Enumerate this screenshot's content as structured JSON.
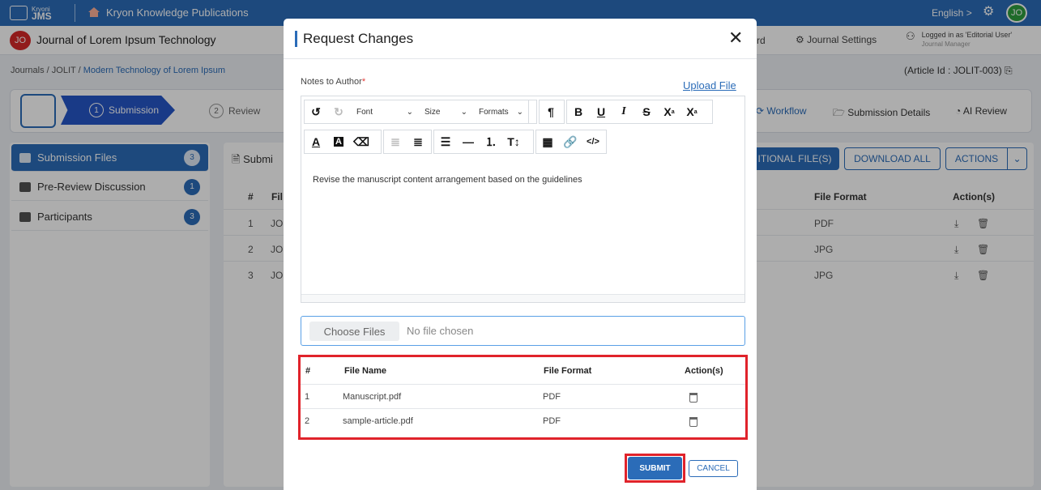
{
  "topbar": {
    "logo_top": "Kryoni",
    "logo_bottom": "JMS",
    "publisher": "Kryon Knowledge Publications",
    "language": "English >",
    "avatar": "JO"
  },
  "journal_bar": {
    "avatar": "JO",
    "title": "Journal of Lorem Ipsum Technology",
    "partial_item": "rd",
    "settings": "Journal Settings",
    "logged_in": "Logged in as 'Editorial User'",
    "role": "Journal Manager"
  },
  "breadcrumb": {
    "journals": "Journals",
    "sep1": "/",
    "code": "JOLIT",
    "sep2": "/",
    "article": "Modern Technology of Lorem Ipsum"
  },
  "article_id": "(Article Id : JOLIT-003)",
  "stepper": {
    "active_num": "1",
    "active_label": "Submission",
    "review_num": "2",
    "review_label": "Review",
    "workflow": "Workflow",
    "submission_details": "Submission Details",
    "ai_review": "AI Review"
  },
  "left_panel": [
    {
      "label": "Submission Files",
      "count": "3"
    },
    {
      "label": "Pre-Review Discussion",
      "count": "1"
    },
    {
      "label": "Participants",
      "count": "3"
    }
  ],
  "main_panel": {
    "title": "Submi",
    "btn_additional": "ITIONAL FILE(S)",
    "btn_download": "DOWNLOAD ALL",
    "btn_actions": "ACTIONS",
    "col_num": "#",
    "col_file": "Fil",
    "col_format": "File Format",
    "col_action": "Action(s)",
    "rows": [
      {
        "num": "1",
        "name": "JO",
        "format": "PDF"
      },
      {
        "num": "2",
        "name": "JO",
        "format": "JPG"
      },
      {
        "num": "3",
        "name": "JO",
        "format": "JPG"
      }
    ]
  },
  "modal": {
    "title": "Request Changes",
    "close": "✕",
    "notes_label": "Notes to Author",
    "required": "*",
    "upload_file": "Upload File",
    "toolbar": {
      "font": "Font",
      "size": "Size",
      "formats": "Formats"
    },
    "editor_text": "Revise the manuscript content arrangement based on the guidelines",
    "choose_files": "Choose Files",
    "no_file": "No file chosen",
    "table": {
      "col_num": "#",
      "col_name": "File Name",
      "col_format": "File Format",
      "col_action": "Action(s)",
      "rows": [
        {
          "num": "1",
          "name": "Manuscript.pdf",
          "format": "PDF"
        },
        {
          "num": "2",
          "name": "sample-article.pdf",
          "format": "PDF"
        }
      ]
    },
    "submit": "SUBMIT",
    "cancel": "CANCEL"
  },
  "colors": {
    "primary": "#2b6cb8",
    "highlight": "#e0232b",
    "success": "#2e9e3e",
    "danger": "#d62828"
  }
}
